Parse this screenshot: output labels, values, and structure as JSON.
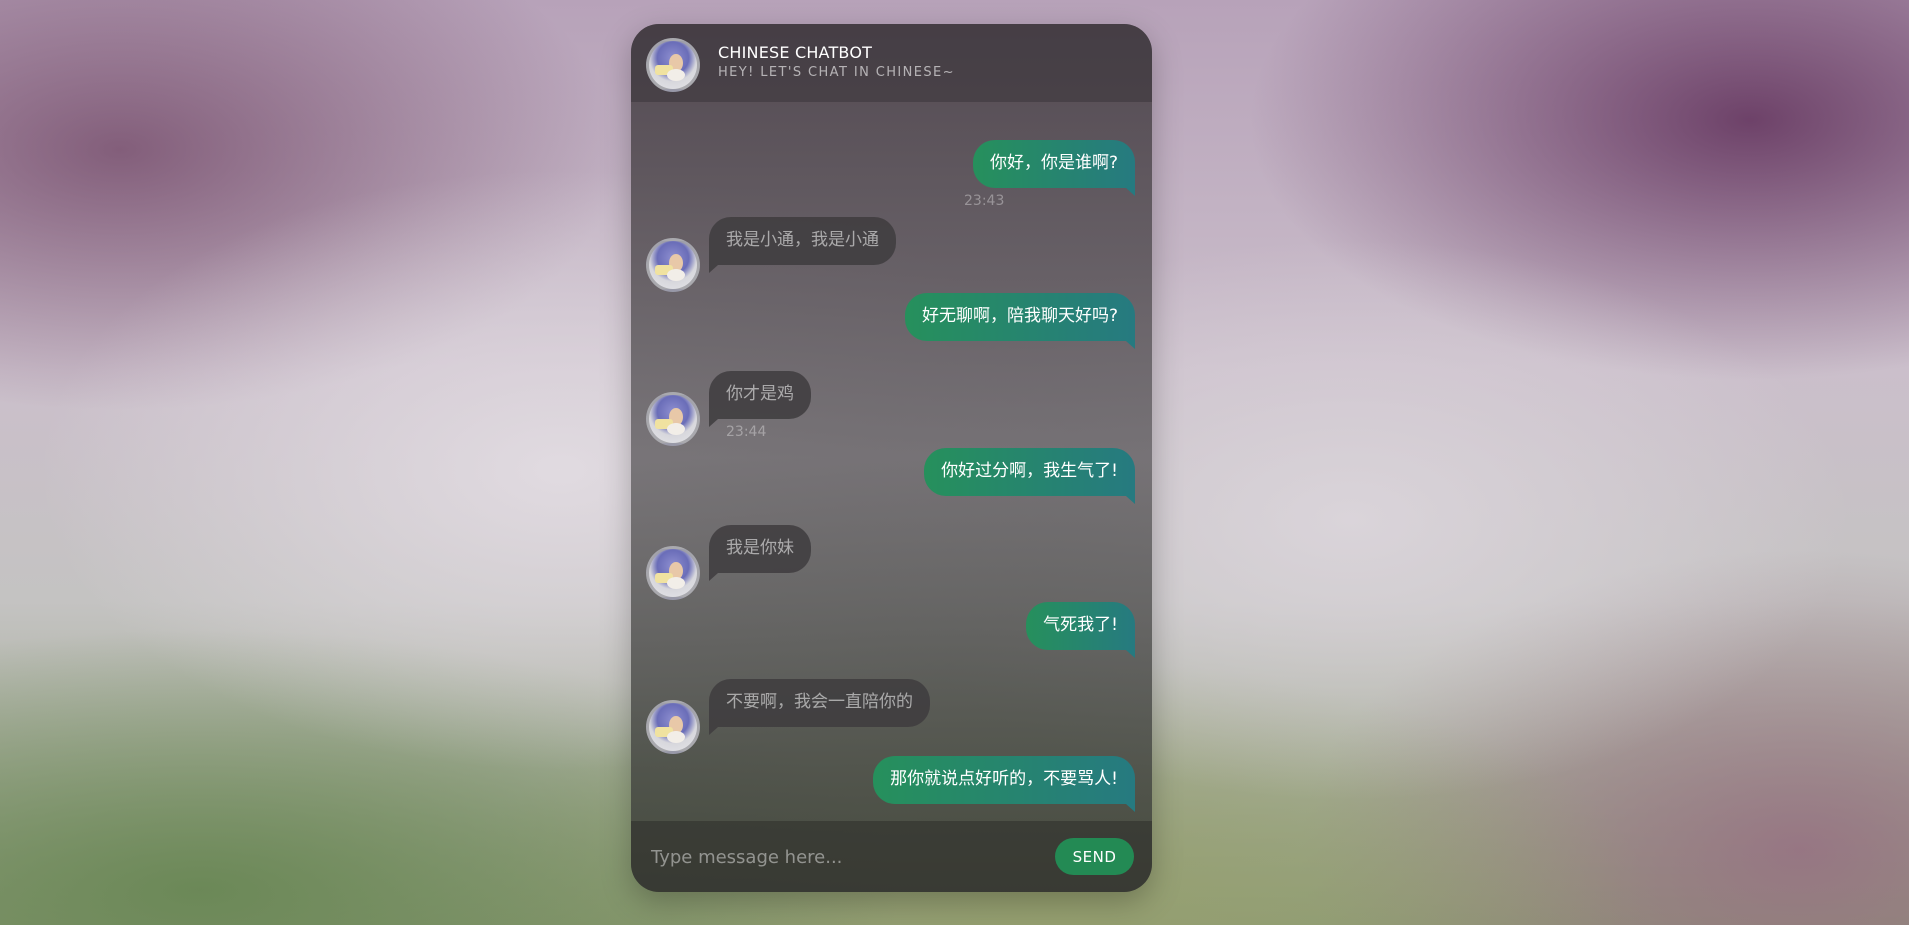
{
  "header": {
    "title": "CHINESE CHATBOT",
    "subtitle": "HEY! LET'S CHAT IN CHINESE~",
    "avatar_icon": "bot-avatar-icon"
  },
  "messages": [
    {
      "from": "user",
      "text": "你好，你是谁啊?",
      "time": "23:43"
    },
    {
      "from": "bot",
      "text": "我是小通，我是小通"
    },
    {
      "from": "user",
      "text": "好无聊啊，陪我聊天好吗?"
    },
    {
      "from": "bot",
      "text": "你才是鸡",
      "time": "23:44"
    },
    {
      "from": "user",
      "text": "你好过分啊，我生气了!"
    },
    {
      "from": "bot",
      "text": "我是你妹"
    },
    {
      "from": "user",
      "text": "气死我了!"
    },
    {
      "from": "bot",
      "text": "不要啊，我会一直陪你的"
    },
    {
      "from": "user",
      "text": "那你就说点好听的，不要骂人!"
    },
    {
      "from": "bot",
      "text": ""
    }
  ],
  "composer": {
    "placeholder": "Type message here...",
    "send_label": "SEND"
  },
  "colors": {
    "user_bubble_start": "#26905c",
    "user_bubble_end": "#267a80",
    "send_button": "#238a54"
  }
}
